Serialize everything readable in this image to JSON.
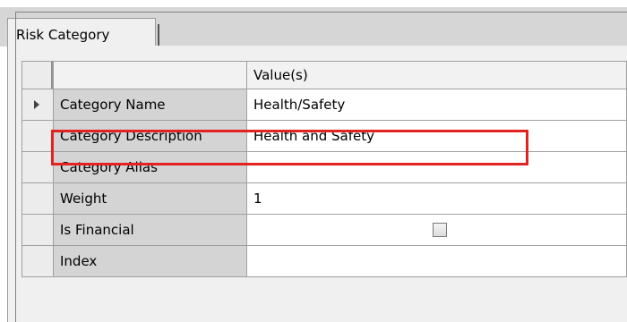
{
  "tab": {
    "label": "Risk Category"
  },
  "grid": {
    "header": {
      "value_column": "Value(s)"
    },
    "rows": [
      {
        "name": "Category Name",
        "value": "Health/Safety",
        "current": true
      },
      {
        "name": "Category Description",
        "value": "Health and Safety",
        "highlighted": true
      },
      {
        "name": "Category Alias",
        "value": ""
      },
      {
        "name": "Weight",
        "value": "1"
      },
      {
        "name": "Is Financial",
        "value_type": "checkbox",
        "checked": false
      },
      {
        "name": "Index",
        "value": ""
      }
    ]
  },
  "colors": {
    "highlight": "#e32222",
    "name_cell": "#d4d4d4",
    "value_cell": "#ffffff"
  }
}
